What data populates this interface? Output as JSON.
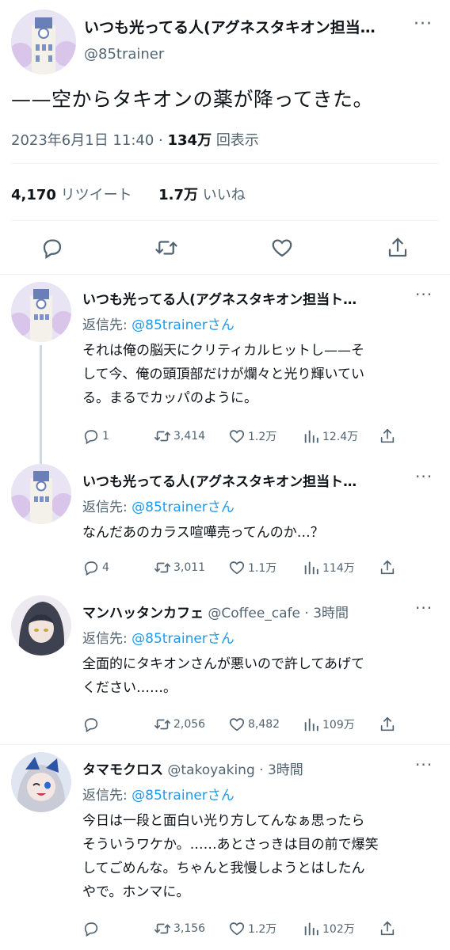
{
  "main_tweet": {
    "name": "いつも光ってる人(アグネスタキオン担当…",
    "handle": "@85trainer",
    "text": "——空からタキオンの薬が降ってきた。",
    "timestamp": "2023年6月1日 11:40",
    "views_count": "134万",
    "views_label": "回表示",
    "retweets_count": "4,170",
    "retweets_label": "リツイート",
    "likes_count": "1.7万",
    "likes_label": "いいね"
  },
  "replies": [
    {
      "name": "いつも光ってる人(アグネスタキオン担当ト…",
      "handle": "",
      "time": "",
      "reply_to_prefix": "返信先: ",
      "reply_to_handle": "@85trainerさん",
      "lines": [
        "それは俺の脳天にクリティカルヒットし——そ",
        "して今、俺の頭頂部だけが爛々と光り輝いてい",
        "る。まるでカッパのように。"
      ],
      "replies": "1",
      "retweets": "3,414",
      "likes": "1.2万",
      "views": "12.4万"
    },
    {
      "name": "いつも光ってる人(アグネスタキオン担当ト…",
      "handle": "",
      "time": "",
      "reply_to_prefix": "返信先: ",
      "reply_to_handle": "@85trainerさん",
      "lines": [
        "なんだあのカラス喧嘩売ってんのか…？"
      ],
      "replies": "4",
      "retweets": "3,011",
      "likes": "1.1万",
      "views": "114万"
    },
    {
      "name": "マンハッタンカフェ",
      "handle": "@Coffee_cafe",
      "time": "· 3時間",
      "reply_to_prefix": "返信先: ",
      "reply_to_handle": "@85trainerさん",
      "lines": [
        "全面的にタキオンさんが悪いので許してあげて",
        "ください……。"
      ],
      "replies": "",
      "retweets": "2,056",
      "likes": "8,482",
      "views": "109万"
    },
    {
      "name": "タマモクロス",
      "handle": "@takoyaking",
      "time": "· 3時間",
      "reply_to_prefix": "返信先: ",
      "reply_to_handle": "@85trainerさん",
      "lines": [
        "今日は一段と面白い光り方してんなぁ思ったら",
        "そういうワケか。……あとさっきは目の前で爆笑",
        "してごめんな。ちゃんと我慢しようとはしたん",
        "やで。ホンマに。"
      ],
      "replies": "",
      "retweets": "3,156",
      "likes": "1.2万",
      "views": "102万"
    }
  ],
  "colors": {
    "accent": "#1d9bf0",
    "muted": "#536471",
    "text": "#0f1419",
    "divider": "#eff3f4"
  },
  "icons": [
    "reply-icon",
    "retweet-icon",
    "like-icon",
    "views-icon",
    "share-icon",
    "more-icon"
  ]
}
